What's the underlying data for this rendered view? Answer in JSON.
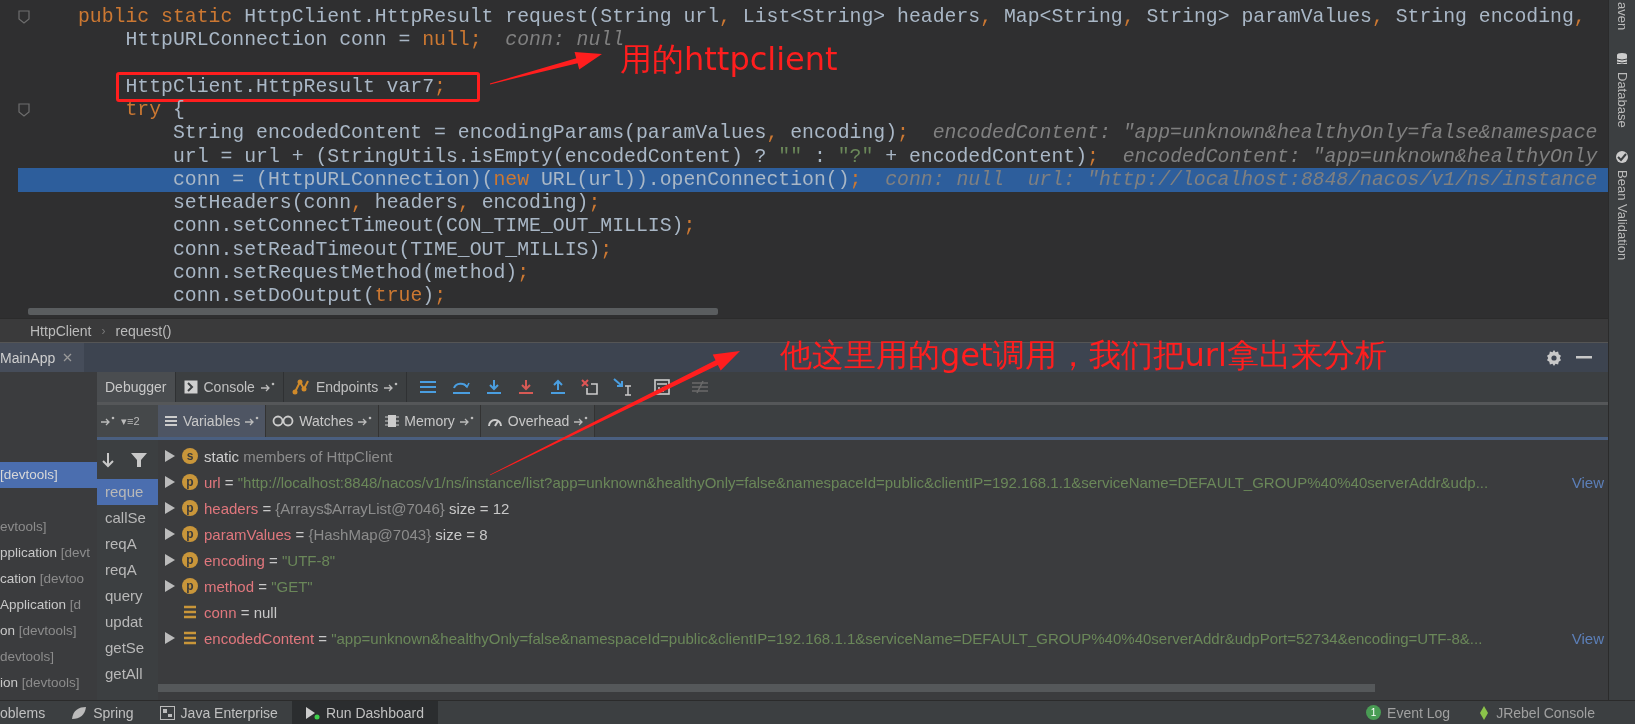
{
  "editor": {
    "lines": [
      {
        "kind": "code",
        "highlighted": false,
        "boxed": false,
        "tokens": [
          {
            "kind": "keyword",
            "text": "public static "
          },
          {
            "kind": "plain",
            "text": "HttpClient.HttpResult request(String url"
          },
          {
            "kind": "keyword",
            "text": ", "
          },
          {
            "kind": "plain",
            "text": "List<String> headers"
          },
          {
            "kind": "keyword",
            "text": ", "
          },
          {
            "kind": "plain",
            "text": "Map<String"
          },
          {
            "kind": "keyword",
            "text": ", "
          },
          {
            "kind": "plain",
            "text": "String> paramValues"
          },
          {
            "kind": "keyword",
            "text": ", "
          },
          {
            "kind": "plain",
            "text": "String encoding"
          },
          {
            "kind": "keyword",
            "text": ","
          }
        ],
        "children": [
          {
            "kind": "code",
            "highlighted": false,
            "boxed": false,
            "tokens": [
              {
                "kind": "plain",
                "text": "HttpURLConnection conn = "
              },
              {
                "kind": "keyword",
                "text": "null;"
              }
            ],
            "hint": "conn: null"
          },
          {
            "kind": "blank",
            "highlighted": false,
            "boxed": false
          },
          {
            "kind": "code",
            "highlighted": false,
            "boxed": true,
            "tokens": [
              {
                "kind": "plain",
                "text": "HttpClient.HttpResult var7"
              },
              {
                "kind": "keyword",
                "text": ";"
              }
            ]
          },
          {
            "kind": "code",
            "highlighted": false,
            "boxed": false,
            "tokens": [
              {
                "kind": "keyword",
                "text": "try "
              },
              {
                "kind": "plain",
                "text": "{"
              }
            ],
            "children": [
              {
                "kind": "code",
                "highlighted": false,
                "boxed": false,
                "tokens": [
                  {
                    "kind": "plain",
                    "text": "String encodedContent = encodingParams(paramValues"
                  },
                  {
                    "kind": "keyword",
                    "text": ", "
                  },
                  {
                    "kind": "plain",
                    "text": "encoding)"
                  },
                  {
                    "kind": "keyword",
                    "text": ";"
                  }
                ],
                "hint": "encodedContent: \"app=unknown&healthyOnly=false&namespace"
              },
              {
                "kind": "code",
                "highlighted": false,
                "boxed": false,
                "tokens": [
                  {
                    "kind": "plain",
                    "text": "url = url + (StringUtils.isEmpty(encodedContent) ? "
                  },
                  {
                    "kind": "string",
                    "text": "\"\""
                  },
                  {
                    "kind": "plain",
                    "text": " : "
                  },
                  {
                    "kind": "string",
                    "text": "\"?\""
                  },
                  {
                    "kind": "plain",
                    "text": " + encodedContent)"
                  },
                  {
                    "kind": "keyword",
                    "text": ";"
                  }
                ],
                "hint": "encodedContent: \"app=unknown&healthyOnly"
              },
              {
                "kind": "code",
                "highlighted": true,
                "boxed": false,
                "tokens": [
                  {
                    "kind": "plain",
                    "text": "conn = (HttpURLConnection)("
                  },
                  {
                    "kind": "keyword",
                    "text": "new "
                  },
                  {
                    "kind": "plain",
                    "text": "URL(url)).openConnection()"
                  },
                  {
                    "kind": "keyword",
                    "text": ";"
                  }
                ],
                "hint": "conn: null  url: \"http://localhost:8848/nacos/v1/ns/instance"
              },
              {
                "kind": "code",
                "highlighted": false,
                "boxed": false,
                "tokens": [
                  {
                    "kind": "plain",
                    "text": "setHeaders(conn"
                  },
                  {
                    "kind": "keyword",
                    "text": ", "
                  },
                  {
                    "kind": "plain",
                    "text": "headers"
                  },
                  {
                    "kind": "keyword",
                    "text": ", "
                  },
                  {
                    "kind": "plain",
                    "text": "encoding)"
                  },
                  {
                    "kind": "keyword",
                    "text": ";"
                  }
                ]
              },
              {
                "kind": "code",
                "highlighted": false,
                "boxed": false,
                "tokens": [
                  {
                    "kind": "plain",
                    "text": "conn.setConnectTimeout(CON_TIME_OUT_MILLIS)"
                  },
                  {
                    "kind": "keyword",
                    "text": ";"
                  }
                ]
              },
              {
                "kind": "code",
                "highlighted": false,
                "boxed": false,
                "tokens": [
                  {
                    "kind": "plain",
                    "text": "conn.setReadTimeout(TIME_OUT_MILLIS)"
                  },
                  {
                    "kind": "keyword",
                    "text": ";"
                  }
                ]
              },
              {
                "kind": "code",
                "highlighted": false,
                "boxed": false,
                "tokens": [
                  {
                    "kind": "plain",
                    "text": "conn.setRequestMethod(method)"
                  },
                  {
                    "kind": "keyword",
                    "text": ";"
                  }
                ]
              },
              {
                "kind": "code",
                "highlighted": false,
                "boxed": false,
                "tokens": [
                  {
                    "kind": "plain",
                    "text": "conn.setDoOutput("
                  },
                  {
                    "kind": "keyword",
                    "text": "true"
                  },
                  {
                    "kind": "plain",
                    "text": ")"
                  },
                  {
                    "kind": "keyword",
                    "text": ";"
                  }
                ]
              }
            ]
          }
        ]
      }
    ],
    "breadcrumb": {
      "separator": "›",
      "items": [
        "HttpClient",
        "request()"
      ]
    }
  },
  "right_stripe": [
    {
      "kind": "text",
      "label": "aven"
    },
    {
      "kind": "database",
      "label": "Database"
    },
    {
      "kind": "bean",
      "label": "Bean Validation"
    }
  ],
  "debug": {
    "session_tab": "MainApp",
    "toolbar_tabs": [
      {
        "label": "Debugger",
        "selected": true
      },
      {
        "label": "Console",
        "selected": false
      },
      {
        "label": "Endpoints",
        "selected": false
      }
    ],
    "thread_selector": "▾≡2",
    "variable_tabs": [
      {
        "label": "Variables",
        "selected": true
      },
      {
        "label": "Watches",
        "selected": false
      },
      {
        "label": "Memory",
        "selected": false
      },
      {
        "label": "Overhead",
        "selected": false
      }
    ],
    "sessions": [
      {
        "tag": "[devtools]",
        "selected": true
      },
      {
        "tag": "evtools]",
        "selected": false
      },
      {
        "name": "pplication",
        "tag": "[devt",
        "selected": false
      },
      {
        "name": "cation",
        "tag": "[devtoo",
        "selected": false
      },
      {
        "name": "Application",
        "tag": "[d",
        "selected": false
      },
      {
        "name": "on",
        "tag": "[devtools]",
        "selected": false
      },
      {
        "tag": "devtools]",
        "selected": false
      },
      {
        "name": "ion",
        "tag": "[devtools]",
        "selected": false
      }
    ],
    "frames": [
      {
        "label": "reque",
        "selected": true
      },
      {
        "label": "callSe",
        "selected": false
      },
      {
        "label": "reqA",
        "selected": false
      },
      {
        "label": "reqA",
        "selected": false
      },
      {
        "label": "query",
        "selected": false
      },
      {
        "label": "updat",
        "selected": false
      },
      {
        "label": "getSe",
        "selected": false
      },
      {
        "label": "getAll",
        "selected": false
      }
    ],
    "variables": [
      {
        "kind": "static",
        "badge": "s",
        "expandable": true,
        "name": "static",
        "value": {
          "kind": "note",
          "text": "members of HttpClient"
        }
      },
      {
        "kind": "param",
        "badge": "p",
        "expandable": true,
        "name": "url",
        "operator": "=",
        "value": {
          "kind": "string",
          "text": "\"http://localhost:8848/nacos/v1/ns/instance/list?app=unknown&healthyOnly=false&namespaceId=public&clientIP=192.168.1.1&serviceName=DEFAULT_GROUP%40%40serverAddr&udp..."
        },
        "link": "View"
      },
      {
        "kind": "param",
        "badge": "p",
        "expandable": true,
        "name": "headers",
        "operator": "=",
        "value": {
          "kind": "object",
          "text": "{Arrays$ArrayList@7046}"
        },
        "extra": "size = 12"
      },
      {
        "kind": "param",
        "badge": "p",
        "expandable": true,
        "name": "paramValues",
        "operator": "=",
        "value": {
          "kind": "object",
          "text": "{HashMap@7043}"
        },
        "extra": "size = 8"
      },
      {
        "kind": "param",
        "badge": "p",
        "expandable": true,
        "name": "encoding",
        "operator": "=",
        "value": {
          "kind": "string",
          "text": "\"UTF-8\""
        }
      },
      {
        "kind": "param",
        "badge": "p",
        "expandable": true,
        "name": "method",
        "operator": "=",
        "value": {
          "kind": "string",
          "text": "\"GET\""
        }
      },
      {
        "kind": "local",
        "expandable": false,
        "name": "conn",
        "operator": "=",
        "value": {
          "kind": "plain",
          "text": "null"
        }
      },
      {
        "kind": "local",
        "expandable": true,
        "name": "encodedContent",
        "operator": "=",
        "value": {
          "kind": "string",
          "text": "\"app=unknown&healthyOnly=false&namespaceId=public&clientIP=192.168.1.1&serviceName=DEFAULT_GROUP%40%40serverAddr&udpPort=52734&encoding=UTF-8&..."
        },
        "link": "View"
      }
    ]
  },
  "bottom_bar": {
    "tabs": [
      {
        "label": "oblems",
        "selected": false
      },
      {
        "label": "Spring",
        "selected": false
      },
      {
        "label": "Java Enterprise",
        "selected": false
      },
      {
        "label": "Run Dashboard",
        "selected": true
      }
    ],
    "event_log": {
      "badge": "1",
      "label": "Event Log"
    },
    "jrebel": "JRebel Console"
  },
  "annotations": [
    {
      "kind": "arrow"
    },
    {
      "kind": "note",
      "text": "用的httpclient"
    },
    {
      "kind": "arrow"
    },
    {
      "kind": "note",
      "text": "他这里用的get调用，我们把url拿出来分析"
    }
  ]
}
